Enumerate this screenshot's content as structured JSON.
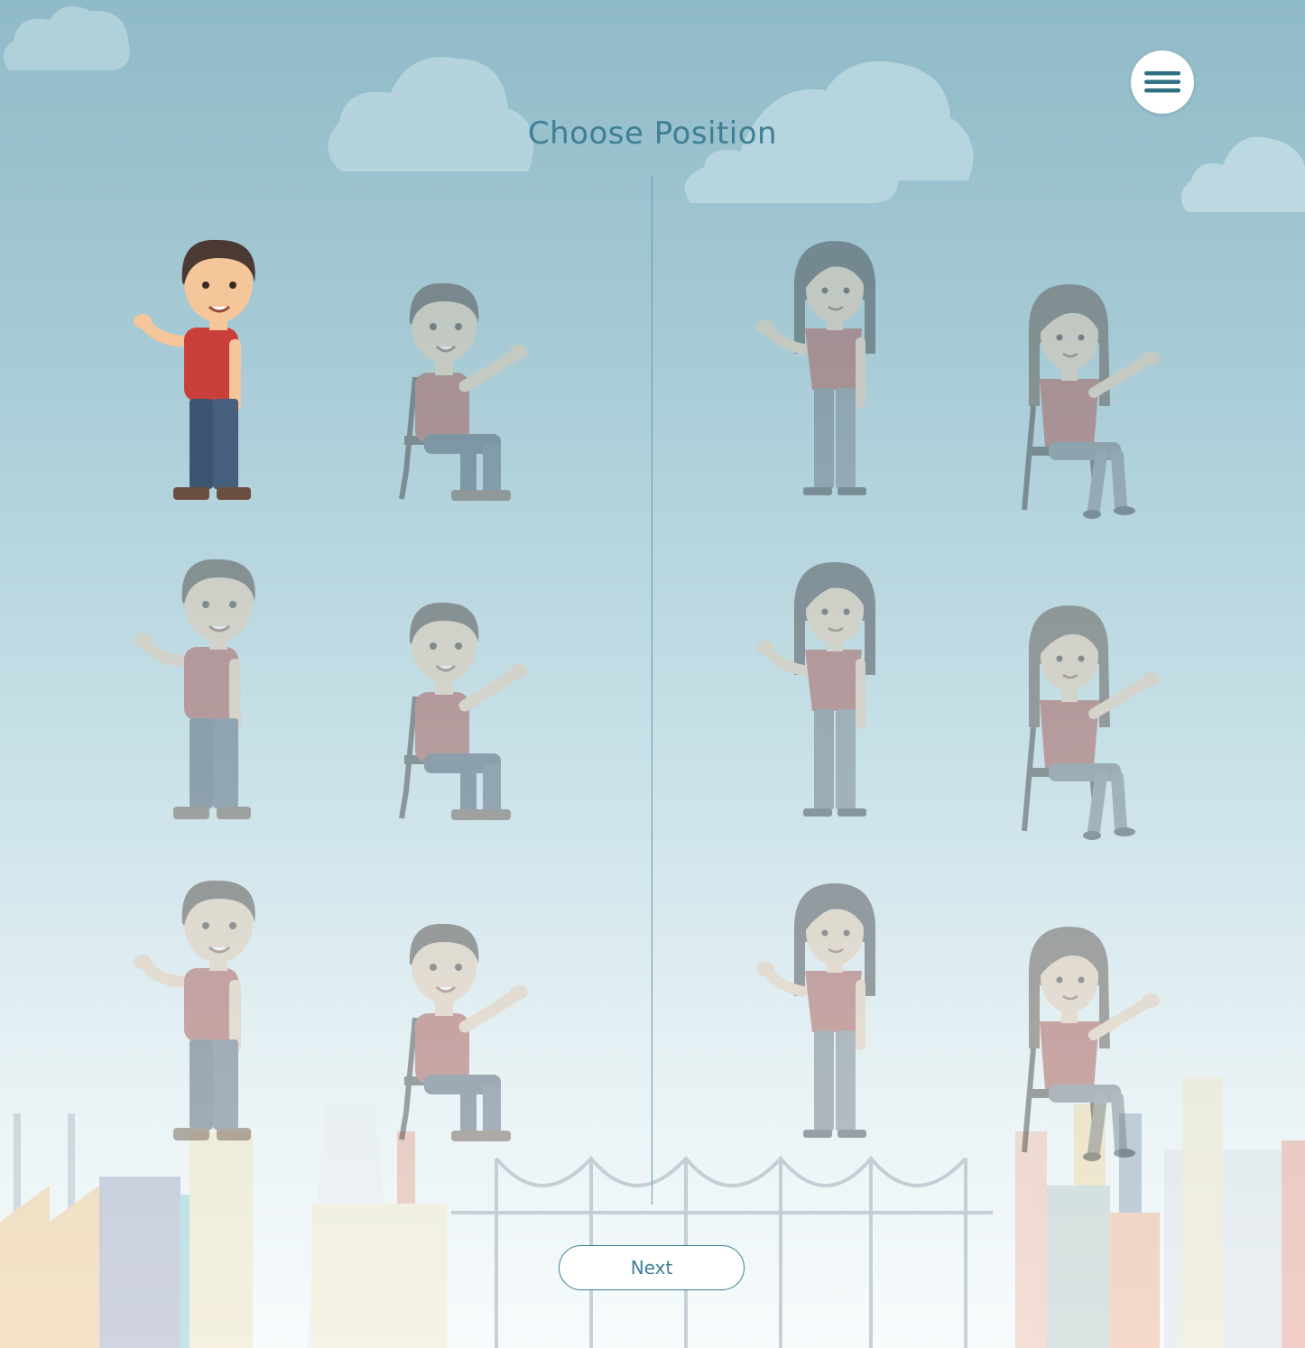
{
  "page": {
    "title": "Choose Position"
  },
  "menu": {
    "icon": "hamburger-menu-icon"
  },
  "characters": {
    "male": [
      {
        "pose": "standing",
        "selected": true
      },
      {
        "pose": "sitting",
        "selected": false
      },
      {
        "pose": "standing",
        "selected": false
      },
      {
        "pose": "sitting",
        "selected": false
      },
      {
        "pose": "standing",
        "selected": false
      },
      {
        "pose": "sitting",
        "selected": false
      }
    ],
    "female": [
      {
        "pose": "standing",
        "selected": false
      },
      {
        "pose": "sitting",
        "selected": false
      },
      {
        "pose": "standing",
        "selected": false
      },
      {
        "pose": "sitting",
        "selected": false
      },
      {
        "pose": "standing",
        "selected": false
      },
      {
        "pose": "sitting",
        "selected": false
      }
    ]
  },
  "footer": {
    "next_label": "Next"
  },
  "colors": {
    "accent": "#3e7f95",
    "shirt": "#c9403a",
    "sky_top": "#8fbac8"
  }
}
